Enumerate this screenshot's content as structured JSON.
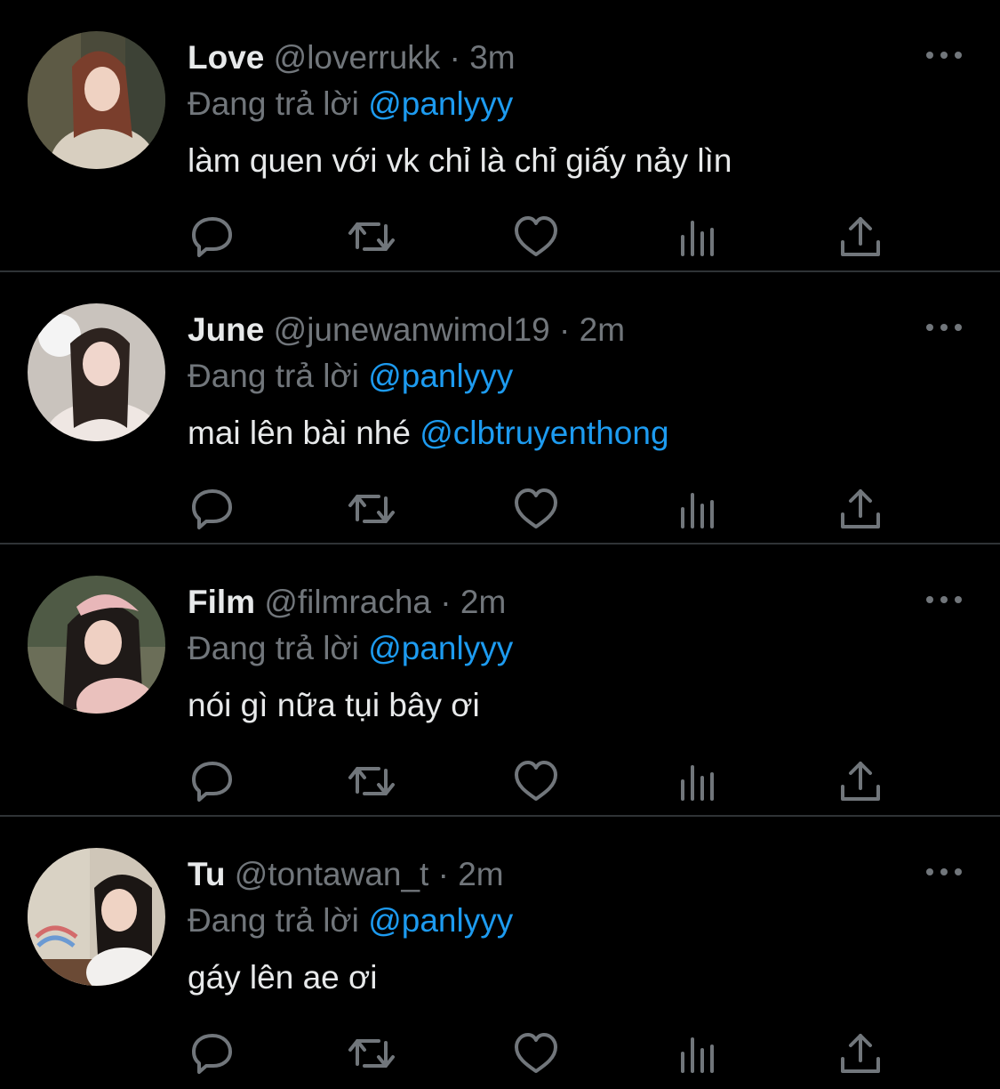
{
  "colors": {
    "background": "#000000",
    "primary_text": "#e7e9ea",
    "secondary_text": "#71767b",
    "accent": "#1d9bf0",
    "divider": "#2f3336"
  },
  "icons": {
    "more": "more-dots-icon",
    "reply": "reply-bubble-icon",
    "retweet": "retweet-icon",
    "like": "heart-icon",
    "views": "views-chart-icon",
    "share": "share-upload-icon"
  },
  "tweets": [
    {
      "name": "Love",
      "handle": "@loverrukk",
      "dot": "·",
      "time": "3m",
      "reply_prefix": "Đang trả lời",
      "reply_to": "@panlyyy",
      "text": "làm quen với vk chỉ là chỉ giấy nảy lìn",
      "mention": ""
    },
    {
      "name": "June",
      "handle": "@junewanwimol19",
      "dot": "·",
      "time": "2m",
      "reply_prefix": "Đang trả lời",
      "reply_to": "@panlyyy",
      "text": "mai lên bài nhé ",
      "mention": "@clbtruyenthong"
    },
    {
      "name": "Film",
      "handle": "@filmracha",
      "dot": "·",
      "time": "2m",
      "reply_prefix": "Đang trả lời",
      "reply_to": "@panlyyy",
      "text": "nói gì nữa tụi bây ơi",
      "mention": ""
    },
    {
      "name": "Tu",
      "handle": "@tontawan_t",
      "dot": "·",
      "time": "2m",
      "reply_prefix": "Đang trả lời",
      "reply_to": "@panlyyy",
      "text": "gáy lên ae ơi",
      "mention": ""
    }
  ]
}
